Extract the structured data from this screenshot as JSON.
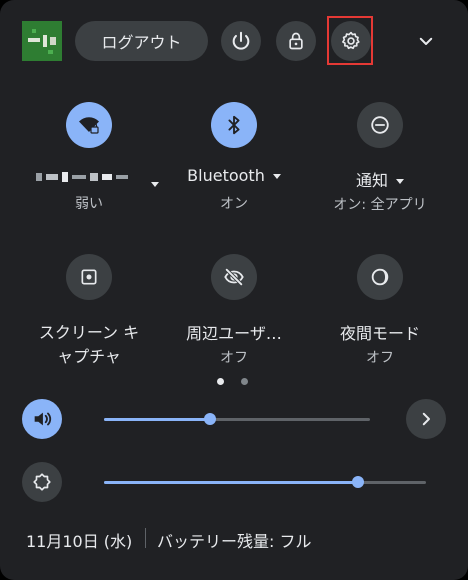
{
  "header": {
    "logout_label": "ログアウト",
    "avatar_color": "#2e7d32"
  },
  "toggles": {
    "row1": [
      {
        "label": "",
        "sub": "弱い",
        "icon": "wifi-lock-icon",
        "active": true
      },
      {
        "label": "Bluetooth",
        "sub": "オン",
        "icon": "bluetooth-icon",
        "active": true
      },
      {
        "label": "通知",
        "sub": "オン: 全アプリ",
        "icon": "notification-icon",
        "active": false
      }
    ],
    "row2": [
      {
        "label_line1": "スクリーン キ",
        "label_line2": "ャプチャ",
        "icon": "screen-capture-icon",
        "active": false
      },
      {
        "label": "周辺ユーザ…",
        "sub": "オフ",
        "icon": "eye-off-icon",
        "active": false
      },
      {
        "label": "夜間モード",
        "sub": "オフ",
        "icon": "night-mode-icon",
        "active": false
      }
    ]
  },
  "pager": {
    "pages": 2,
    "current": 1
  },
  "sliders": {
    "volume": {
      "value_fraction": 0.4,
      "icon": "volume-icon"
    },
    "brightness": {
      "value_fraction": 0.79,
      "icon": "brightness-icon"
    }
  },
  "footer": {
    "date": "11月10日 (水)",
    "battery": "バッテリー残量: フル"
  },
  "colors": {
    "panel": "#202124",
    "button": "#3c4043",
    "accent": "#8ab4f8",
    "highlight": "#e53935"
  }
}
